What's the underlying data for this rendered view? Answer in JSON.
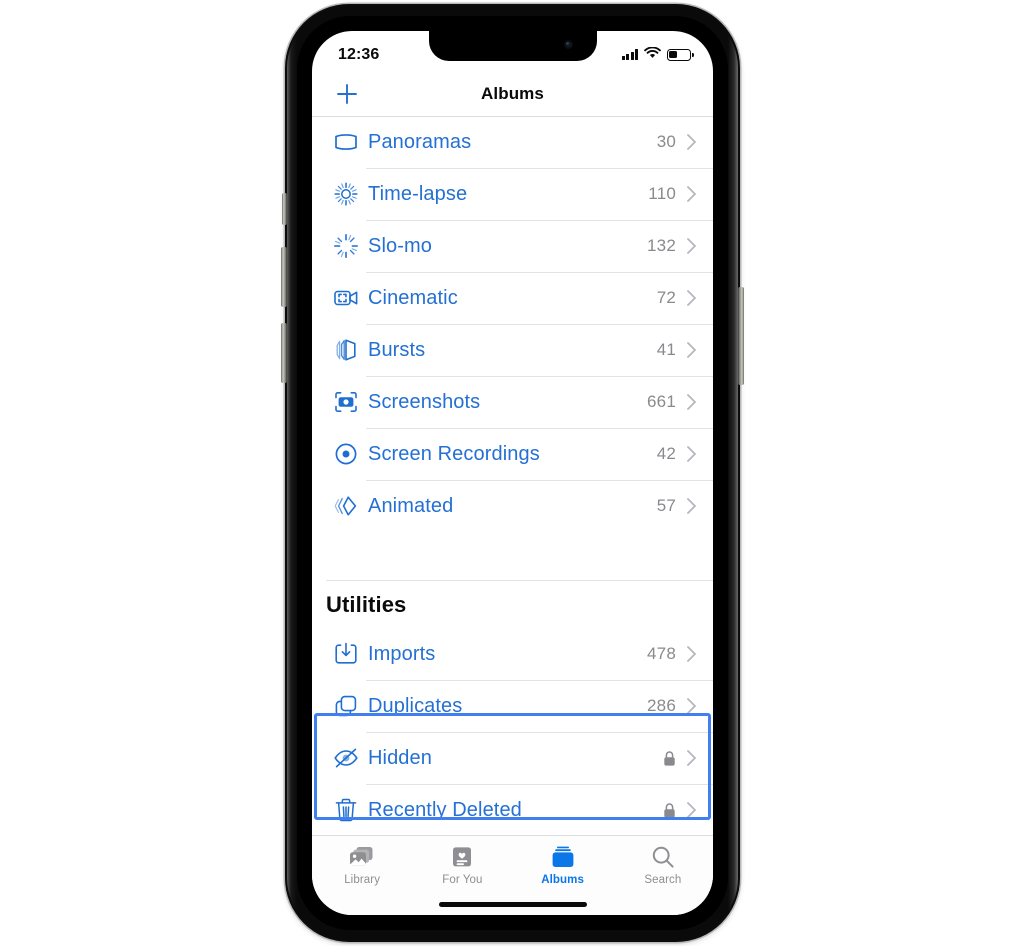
{
  "device": {
    "name": "iphone-frame",
    "buttons": [
      "silent-switch",
      "volume-up",
      "volume-down",
      "power-button"
    ]
  },
  "status_bar": {
    "time": "12:36",
    "cellular_icon": "cellular-signal-icon",
    "wifi_icon": "wifi-icon",
    "battery_icon": "battery-icon",
    "battery_level_percent": 35
  },
  "nav_bar": {
    "add_icon": "plus-icon",
    "title": "Albums"
  },
  "media_types": {
    "rows": [
      {
        "label": "Panoramas",
        "count": "30",
        "icon": "panorama-icon"
      },
      {
        "label": "Time-lapse",
        "count": "110",
        "icon": "timelapse-icon"
      },
      {
        "label": "Slo-mo",
        "count": "132",
        "icon": "slomo-icon"
      },
      {
        "label": "Cinematic",
        "count": "72",
        "icon": "cinematic-video-icon"
      },
      {
        "label": "Bursts",
        "count": "41",
        "icon": "bursts-icon"
      },
      {
        "label": "Screenshots",
        "count": "661",
        "icon": "screenshot-icon"
      },
      {
        "label": "Screen Recordings",
        "count": "42",
        "icon": "screen-recording-icon"
      },
      {
        "label": "Animated",
        "count": "57",
        "icon": "animated-icon"
      }
    ]
  },
  "utilities": {
    "header": "Utilities",
    "rows": [
      {
        "label": "Imports",
        "count": "478",
        "icon": "import-icon",
        "locked": false
      },
      {
        "label": "Duplicates",
        "count": "286",
        "icon": "duplicates-icon",
        "locked": false
      },
      {
        "label": "Hidden",
        "count": "",
        "icon": "hidden-eye-icon",
        "locked": true
      },
      {
        "label": "Recently Deleted",
        "count": "",
        "icon": "trash-icon",
        "locked": true
      }
    ]
  },
  "highlight": {
    "color": "#3f7ff0",
    "targets": [
      "Hidden",
      "Recently Deleted"
    ]
  },
  "tab_bar": {
    "tabs": [
      {
        "label": "Library",
        "icon": "photo-stack-icon",
        "active": false
      },
      {
        "label": "For You",
        "icon": "for-you-card-icon",
        "active": false
      },
      {
        "label": "Albums",
        "icon": "albums-stack-icon",
        "active": true
      },
      {
        "label": "Search",
        "icon": "search-icon",
        "active": false
      }
    ]
  },
  "colors": {
    "accent_blue": "#2470d4",
    "tab_active_blue": "#0a76e8",
    "count_gray": "#8a8a8e",
    "highlight_blue": "#3f7ff0"
  }
}
